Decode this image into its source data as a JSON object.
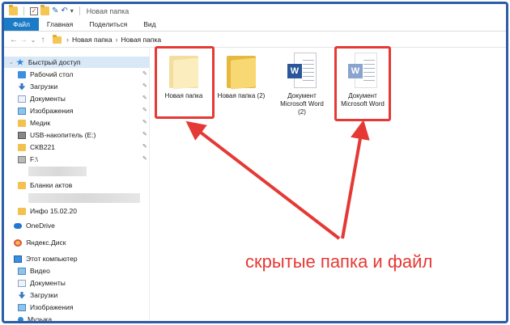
{
  "window": {
    "title": "Новая папка",
    "quick_access_toolbar": [
      "checkbox-icon",
      "folder-icon",
      "properties-icon",
      "undo-icon",
      "dropdown-icon"
    ]
  },
  "ribbon": {
    "tabs": [
      "Файл",
      "Главная",
      "Поделиться",
      "Вид"
    ],
    "active_tab": "Файл",
    "accent_color": "#1c7bc7"
  },
  "address": {
    "breadcrumb": [
      "Новая папка",
      "Новая папка"
    ]
  },
  "sidebar": {
    "quick_access_label": "Быстрый доступ",
    "pinned": [
      {
        "label": "Рабочий стол",
        "icon": "folder-blue-icon"
      },
      {
        "label": "Загрузки",
        "icon": "download-icon"
      },
      {
        "label": "Документы",
        "icon": "documents-icon"
      },
      {
        "label": "Изображения",
        "icon": "pictures-icon"
      },
      {
        "label": "Медик",
        "icon": "folder-icon"
      },
      {
        "label": "USB-накопитель (E:)",
        "icon": "usb-drive-icon"
      },
      {
        "label": "СКВ221",
        "icon": "folder-icon"
      },
      {
        "label": "F:\\",
        "icon": "drive-icon"
      }
    ],
    "other": [
      {
        "label": "Бланки актов",
        "icon": "folder-icon"
      },
      {
        "label": "Инфо 15.02.20",
        "icon": "folder-icon"
      }
    ],
    "onedrive_label": "OneDrive",
    "yandex_label": "Яндекс.Диск",
    "this_pc_label": "Этот компьютер",
    "this_pc_items": [
      {
        "label": "Видео",
        "icon": "video-icon"
      },
      {
        "label": "Документы",
        "icon": "documents-icon"
      },
      {
        "label": "Загрузки",
        "icon": "download-icon"
      },
      {
        "label": "Изображения",
        "icon": "pictures-icon"
      },
      {
        "label": "Музыка",
        "icon": "music-icon"
      }
    ]
  },
  "content": {
    "items": [
      {
        "label": "Новая папка",
        "type": "folder",
        "hidden": true,
        "highlighted": true
      },
      {
        "label": "Новая папка (2)",
        "type": "folder",
        "hidden": false,
        "highlighted": false
      },
      {
        "label_lines": [
          "Документ",
          "Microsoft Word",
          "(2)"
        ],
        "type": "word",
        "hidden": false,
        "highlighted": false
      },
      {
        "label_lines": [
          "Документ",
          "Microsoft Word"
        ],
        "type": "word",
        "hidden": true,
        "highlighted": true
      }
    ]
  },
  "annotation": {
    "caption": "скрытые папка и файл",
    "color": "#e53935"
  }
}
